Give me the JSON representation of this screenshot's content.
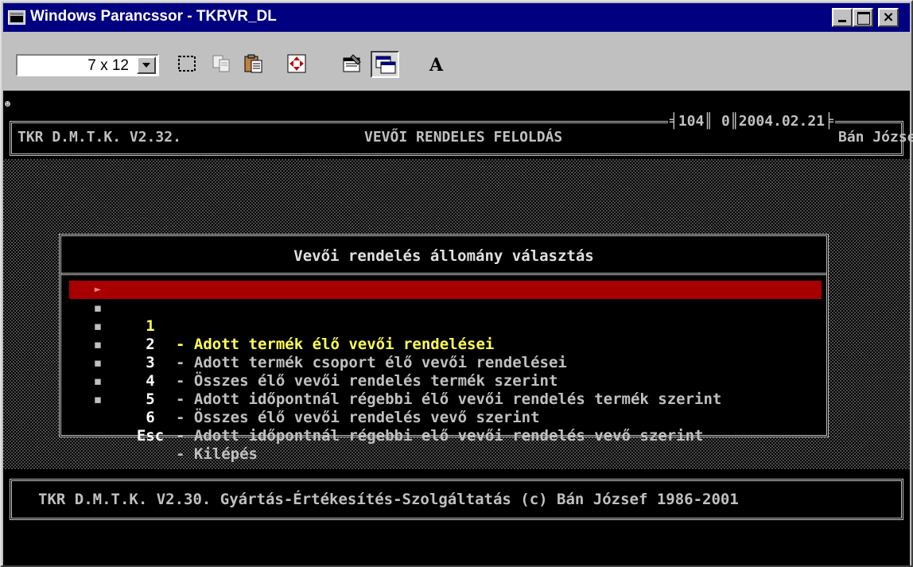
{
  "window": {
    "title": "Windows Parancssor - TKRVR_DL",
    "close_glyph": "×"
  },
  "toolbar": {
    "font_size": "7 x 12",
    "buttons": [
      "mark-icon",
      "copy-icon",
      "paste-icon",
      "fullscreen-icon",
      "properties-icon",
      "background-icon",
      "font-icon"
    ],
    "font_button_label": "A"
  },
  "console": {
    "smiley": "☻",
    "header": {
      "app": "TKR D.M.T.K. V2.32.",
      "screen_title": "VEVŐI RENDELES FELOLDÁS",
      "stats": "╡104║ 0║2004.02.21╞",
      "user": "Bán József"
    },
    "menu": {
      "title": "Vevői rendelés állomány választás",
      "items": [
        {
          "bullet": "►",
          "key": "1",
          "label": "- Adott termék élő vevői rendelései"
        },
        {
          "bullet": "▪",
          "key": "2",
          "label": "- Adott termék csoport élő vevői rendelései"
        },
        {
          "bullet": "▪",
          "key": "3",
          "label": "- Összes élő vevői rendelés termék szerint"
        },
        {
          "bullet": "▪",
          "key": "4",
          "label": "- Adott időpontnál régebbi élő vevői rendelés termék szerint"
        },
        {
          "bullet": "▪",
          "key": "5",
          "label": "- Összes élő vevői rendelés vevő szerint"
        },
        {
          "bullet": "▪",
          "key": "6",
          "label": "- Adott időpontnál régebbi elő vevői rendelés vevő szerint"
        },
        {
          "bullet": "▪",
          "key": "Esc",
          "label": "- Kilépés"
        }
      ],
      "selected_index": 0
    },
    "footer": "TKR D.M.T.K. V2.30. Gyártás-Értékesítés-Szolgáltatás (c) Bán József 1986-2001"
  },
  "colors": {
    "title_bar": "#000080",
    "selection_bg": "#a80000",
    "selection_fg": "#ffff55",
    "console_text": "#c0c0c0"
  }
}
